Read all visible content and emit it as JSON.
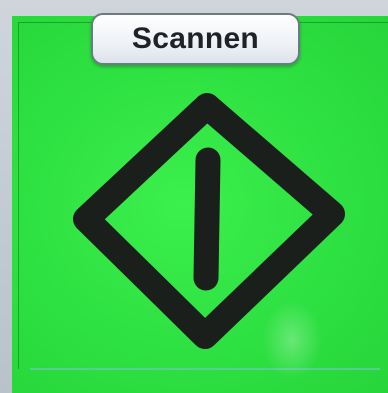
{
  "toolbar": {
    "scan_label": "Scannen"
  },
  "status": {
    "icon": "diamond-exclamation-warning-icon",
    "background_color": "#2fe045",
    "icon_color": "#1a1f1c"
  }
}
